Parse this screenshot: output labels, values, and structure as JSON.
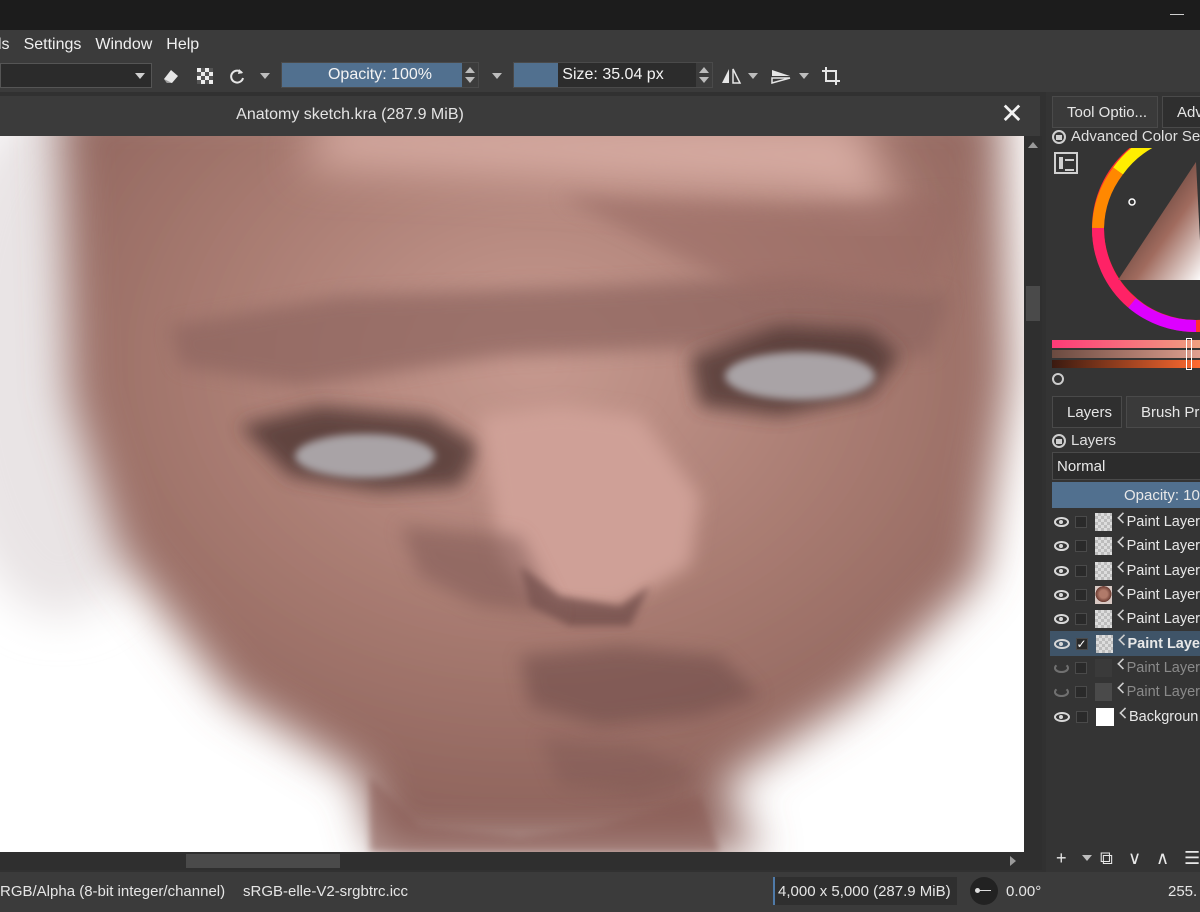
{
  "window": {
    "minimize_label": ""
  },
  "menu": [
    "ls",
    "Settings",
    "Window",
    "Help"
  ],
  "toolbar": {
    "opacity_label": "Opacity: 100%",
    "opacity_value": 1.0,
    "size_label": "Size: 35.04 px",
    "size_fill": 0.22,
    "icons": [
      "eraser-icon",
      "alpha-lock-icon",
      "reload-preset-icon",
      "mirror-horizontal-icon",
      "mirror-vertical-icon",
      "crop-icon"
    ]
  },
  "document": {
    "title": "Anatomy sketch.kra (287.9 MiB)",
    "close_glyph": "✕"
  },
  "dockers": {
    "tabs": [
      "Tool Optio...",
      "Adv"
    ],
    "color_title": "Advanced Color Sele",
    "layer_tabs": [
      "Layers",
      "Brush Pre"
    ],
    "layers_title": "Layers",
    "blend_mode": "Normal",
    "opacity_label": "Opacity: 10"
  },
  "layers": [
    {
      "name": "Paint Layer",
      "visible": true,
      "thumb": "sketch",
      "selected": false
    },
    {
      "name": "Paint Layer",
      "visible": true,
      "thumb": "checker",
      "selected": false
    },
    {
      "name": "Paint Layer",
      "visible": true,
      "thumb": "checker",
      "selected": false
    },
    {
      "name": "Paint Layer",
      "visible": true,
      "thumb": "face",
      "selected": false
    },
    {
      "name": "Paint Layer",
      "visible": true,
      "thumb": "checker",
      "selected": false
    },
    {
      "name": "Paint Laye",
      "visible": true,
      "thumb": "checker",
      "selected": true,
      "checked": "✓"
    },
    {
      "name": "Paint Layer",
      "visible": false,
      "thumb": "darkbar",
      "selected": false
    },
    {
      "name": "Paint Layer",
      "visible": false,
      "thumb": "dark",
      "selected": false
    },
    {
      "name": "Backgroun",
      "visible": true,
      "thumb": "white",
      "selected": false
    }
  ],
  "status": {
    "colorspace": "RGB/Alpha (8-bit integer/channel)",
    "profile": "sRGB-elle-V2-srgbtrc.icc",
    "dimensions": "4,000 x 5,000 (287.9 MiB)",
    "rotation": "0.00°",
    "zoom": "255."
  },
  "colors": {
    "accent": "#51708f",
    "selection": "#3f5468",
    "bg": "#3b3b3b"
  }
}
